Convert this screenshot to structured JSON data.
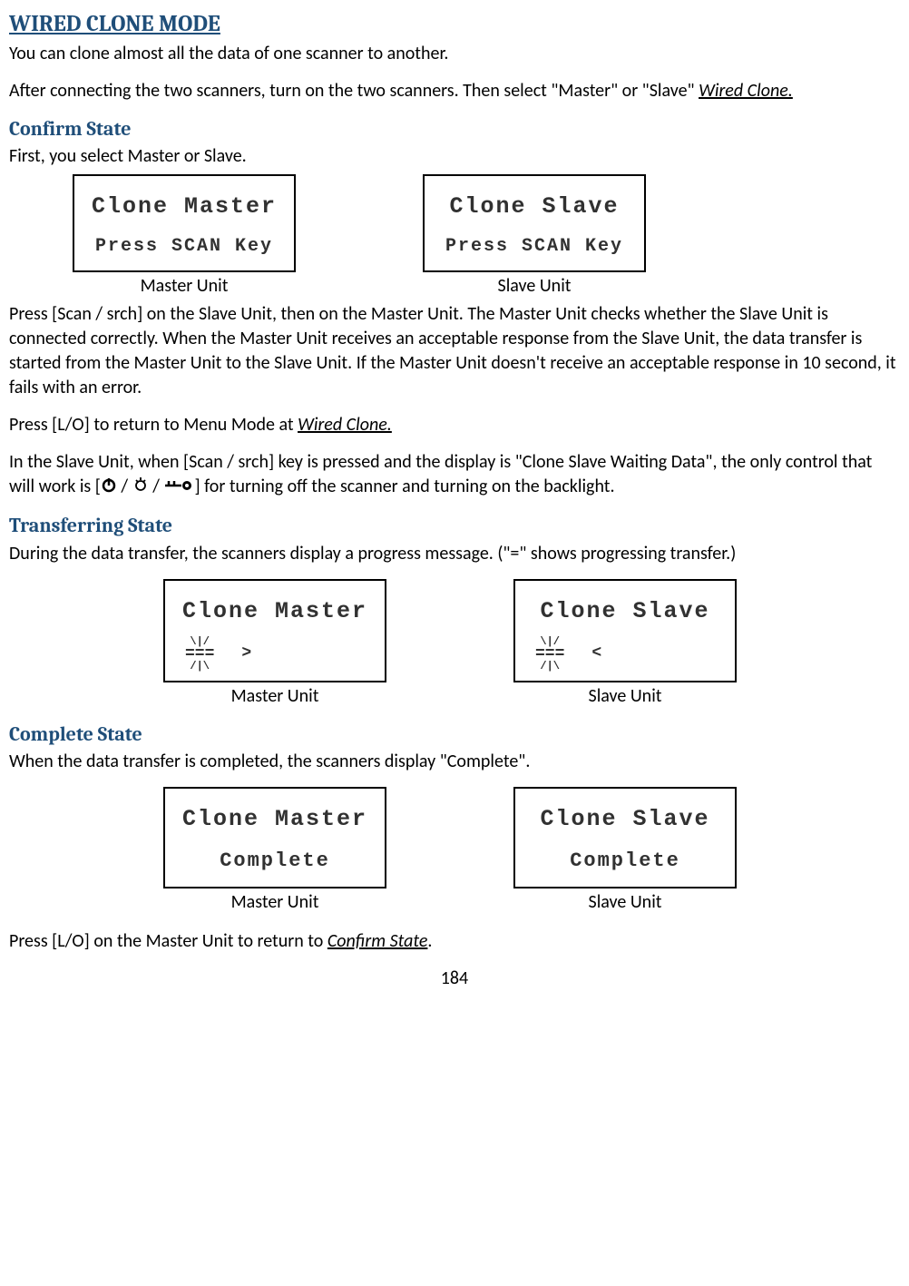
{
  "title": "WIRED CLONE MODE",
  "intro1": "You can clone almost all the data of one scanner to another.",
  "intro2_a": "After connecting the two scanners, turn on the two scanners. Then select \"Master\" or \"Slave\"  ",
  "intro2_link": "Wired Clone.",
  "confirm": {
    "heading": "Confirm State",
    "text1": "First, you select Master or Slave.",
    "master_screen_l1": "Clone Master",
    "master_screen_l2": "Press SCAN Key",
    "master_label": "Master Unit",
    "slave_screen_l1": "Clone Slave",
    "slave_screen_l2": "Press SCAN Key",
    "slave_label": "Slave Unit",
    "para2": "Press [Scan / srch] on the Slave Unit, then on the Master Unit. The Master Unit checks whether the Slave Unit is connected correctly. When the Master Unit receives an acceptable response from the Slave Unit, the data transfer is started from the Master Unit to the Slave Unit. If the Master Unit doesn't receive an acceptable response in 10 second, it fails with an error.",
    "para3_a": "Press [L/O] to return to Menu Mode at ",
    "para3_link": "Wired Clone.",
    "para4_a": "In the Slave Unit, when [Scan / srch] key is pressed and the display is \"Clone Slave Waiting Data\", the only control that will work is [",
    "para4_b": " / ",
    "para4_c": " / ",
    "para4_d": "] for turning off the scanner and turning on the backlight."
  },
  "transfer": {
    "heading": "Transferring State",
    "text1": "During the data transfer, the scanners display a progress message. (\"=\" shows progressing transfer.)",
    "master_screen_l1": "Clone Master",
    "master_arrow": ">",
    "master_label": "Master Unit",
    "slave_screen_l1": "Clone Slave",
    "slave_arrow": "<",
    "slave_label": "Slave Unit",
    "bar": "===",
    "rays_top": "\\|/",
    "rays_bot": "/|\\"
  },
  "complete": {
    "heading": "Complete State",
    "text1": "When the data transfer is completed, the scanners display \"Complete\".",
    "master_screen_l1": "Clone Master",
    "master_screen_l2": "Complete",
    "master_label": "Master Unit",
    "slave_screen_l1": "Clone Slave",
    "slave_screen_l2": "Complete",
    "slave_label": "Slave Unit",
    "para2_a": "Press [L/O] on the Master Unit to return to ",
    "para2_link": "Confirm State",
    "para2_b": "."
  },
  "page": "184"
}
